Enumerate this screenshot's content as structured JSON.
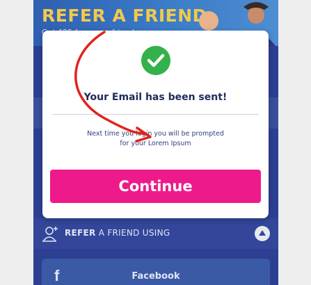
{
  "hero": {
    "title": "REFER A FRIEND",
    "subtitle": "Get £25 for every friend"
  },
  "modal": {
    "icon": "check-circle-icon",
    "title": "Your Email has been sent!",
    "message_line1": "Next time you login you will be prompted",
    "message_line2": "for your Lorem Ipsum",
    "continue_label": "Continue"
  },
  "refer": {
    "icon": "add-user-icon",
    "label_strong": "REFER",
    "label_rest": " A FRIEND USING",
    "toggle_icon": "chevron-up-icon"
  },
  "facebook": {
    "icon": "facebook-icon",
    "label": "Facebook"
  },
  "colors": {
    "accent_pink": "#ee1a8c",
    "success_green": "#33b14a",
    "brand_blue": "#2d3f93",
    "annotation_red": "#e0241b"
  }
}
